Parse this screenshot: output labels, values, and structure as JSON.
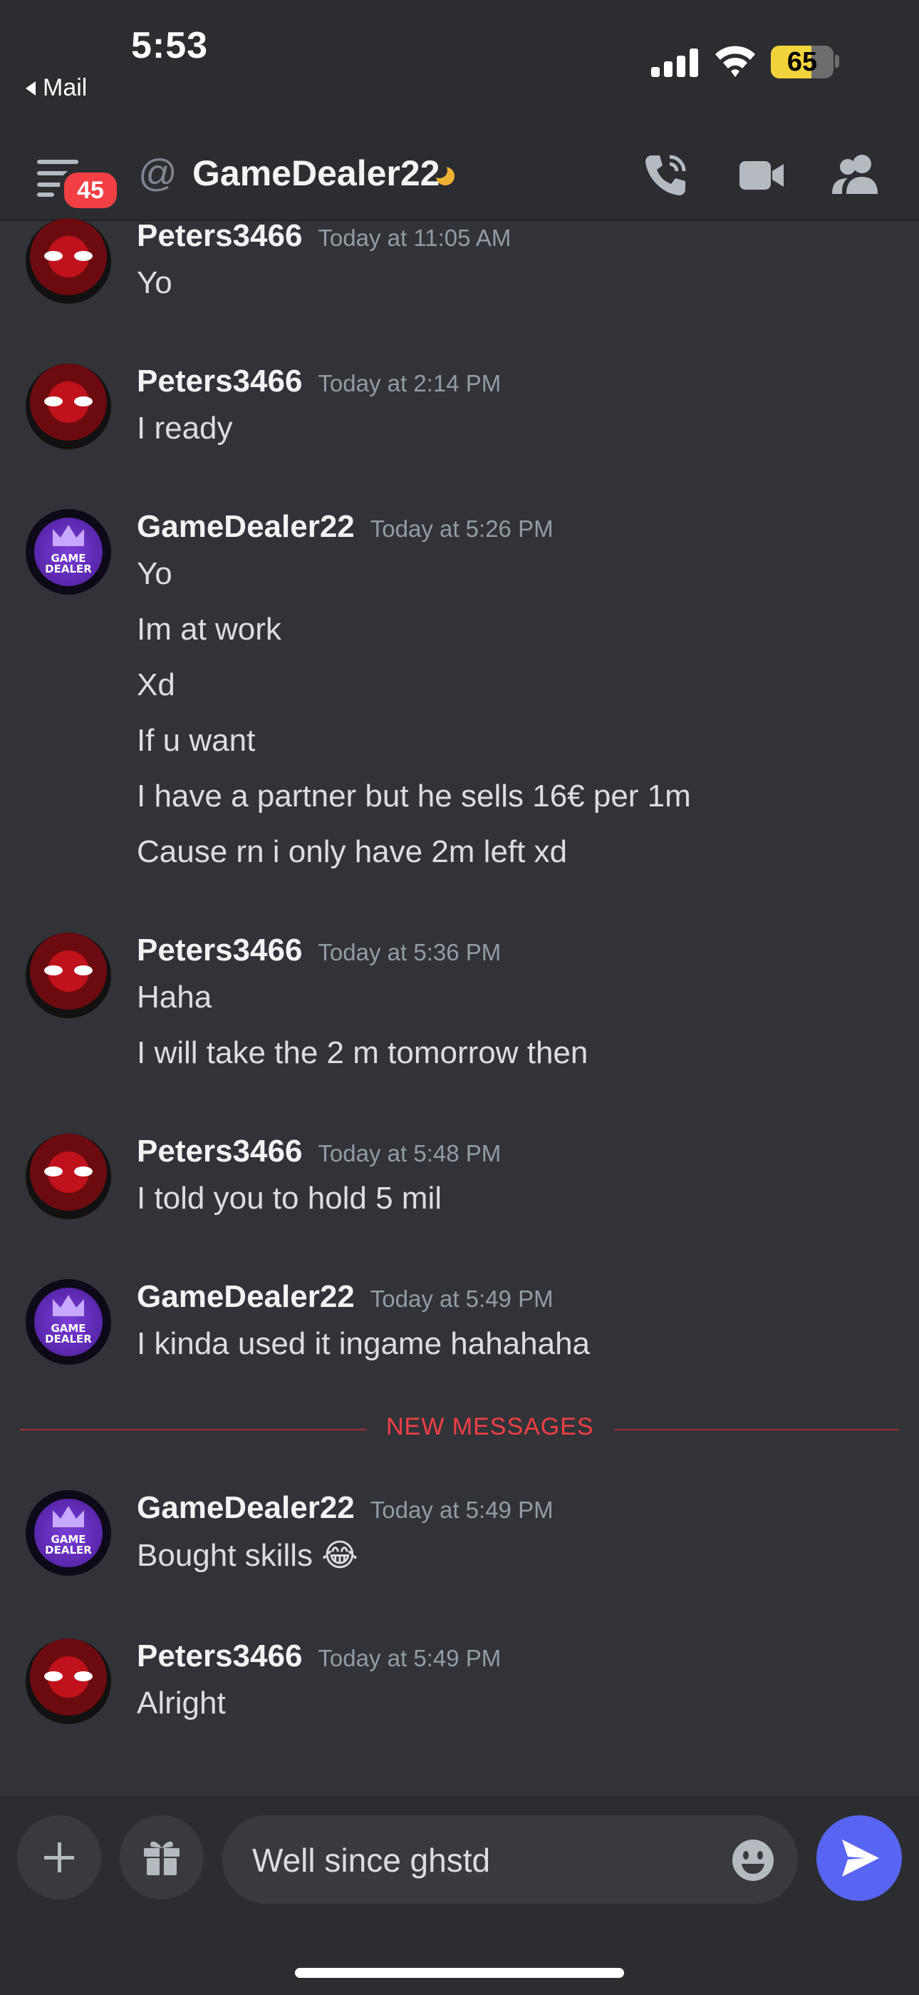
{
  "status_bar": {
    "time": "5:53",
    "back_app": "Mail",
    "battery": "65",
    "battery_level": 0.65
  },
  "header": {
    "unread_badge": "45",
    "channel_name": "GameDealer22",
    "status": "idle",
    "icons": [
      "menu-icon",
      "call-icon",
      "video-icon",
      "members-icon"
    ]
  },
  "messages": [
    {
      "author": "Peters3466",
      "avatar": "spiderman",
      "timestamp": "Today at 11:05 AM",
      "lines": [
        "Yo"
      ]
    },
    {
      "author": "Peters3466",
      "avatar": "spiderman",
      "timestamp": "Today at 2:14 PM",
      "lines": [
        "I ready"
      ]
    },
    {
      "author": "GameDealer22",
      "avatar": "game-dealer",
      "timestamp": "Today at 5:26 PM",
      "lines": [
        "Yo",
        "Im at work",
        "Xd",
        "If u want",
        "I have a partner but he sells 16€ per 1m",
        "Cause rn i only have 2m left xd"
      ]
    },
    {
      "author": "Peters3466",
      "avatar": "spiderman",
      "timestamp": "Today at 5:36 PM",
      "lines": [
        "Haha",
        "I will take the 2 m tomorrow then"
      ]
    },
    {
      "author": "Peters3466",
      "avatar": "spiderman",
      "timestamp": "Today at 5:48 PM",
      "lines": [
        "I told you to hold 5 mil"
      ]
    },
    {
      "author": "GameDealer22",
      "avatar": "game-dealer",
      "timestamp": "Today at 5:49 PM",
      "lines": [
        "I kinda used it ingame hahahaha"
      ]
    },
    {
      "author": "GameDealer22",
      "avatar": "game-dealer",
      "timestamp": "Today at 5:49 PM",
      "lines": [
        "Bought skills 😂"
      ]
    },
    {
      "author": "Peters3466",
      "avatar": "spiderman",
      "timestamp": "Today at 5:49 PM",
      "lines": [
        "Alright"
      ]
    }
  ],
  "avatar_text": {
    "game_dealer": "GAME\nDEALER"
  },
  "new_messages_label": "NEW MESSAGES",
  "composer": {
    "value": "Well since ghstd",
    "icons": [
      "plus-icon",
      "gift-icon",
      "emoji-icon",
      "send-icon"
    ]
  },
  "colors": {
    "background": "#313338",
    "header": "#2b2d31",
    "accent": "#5865f2",
    "danger": "#f23f43",
    "idle": "#f0b232"
  }
}
